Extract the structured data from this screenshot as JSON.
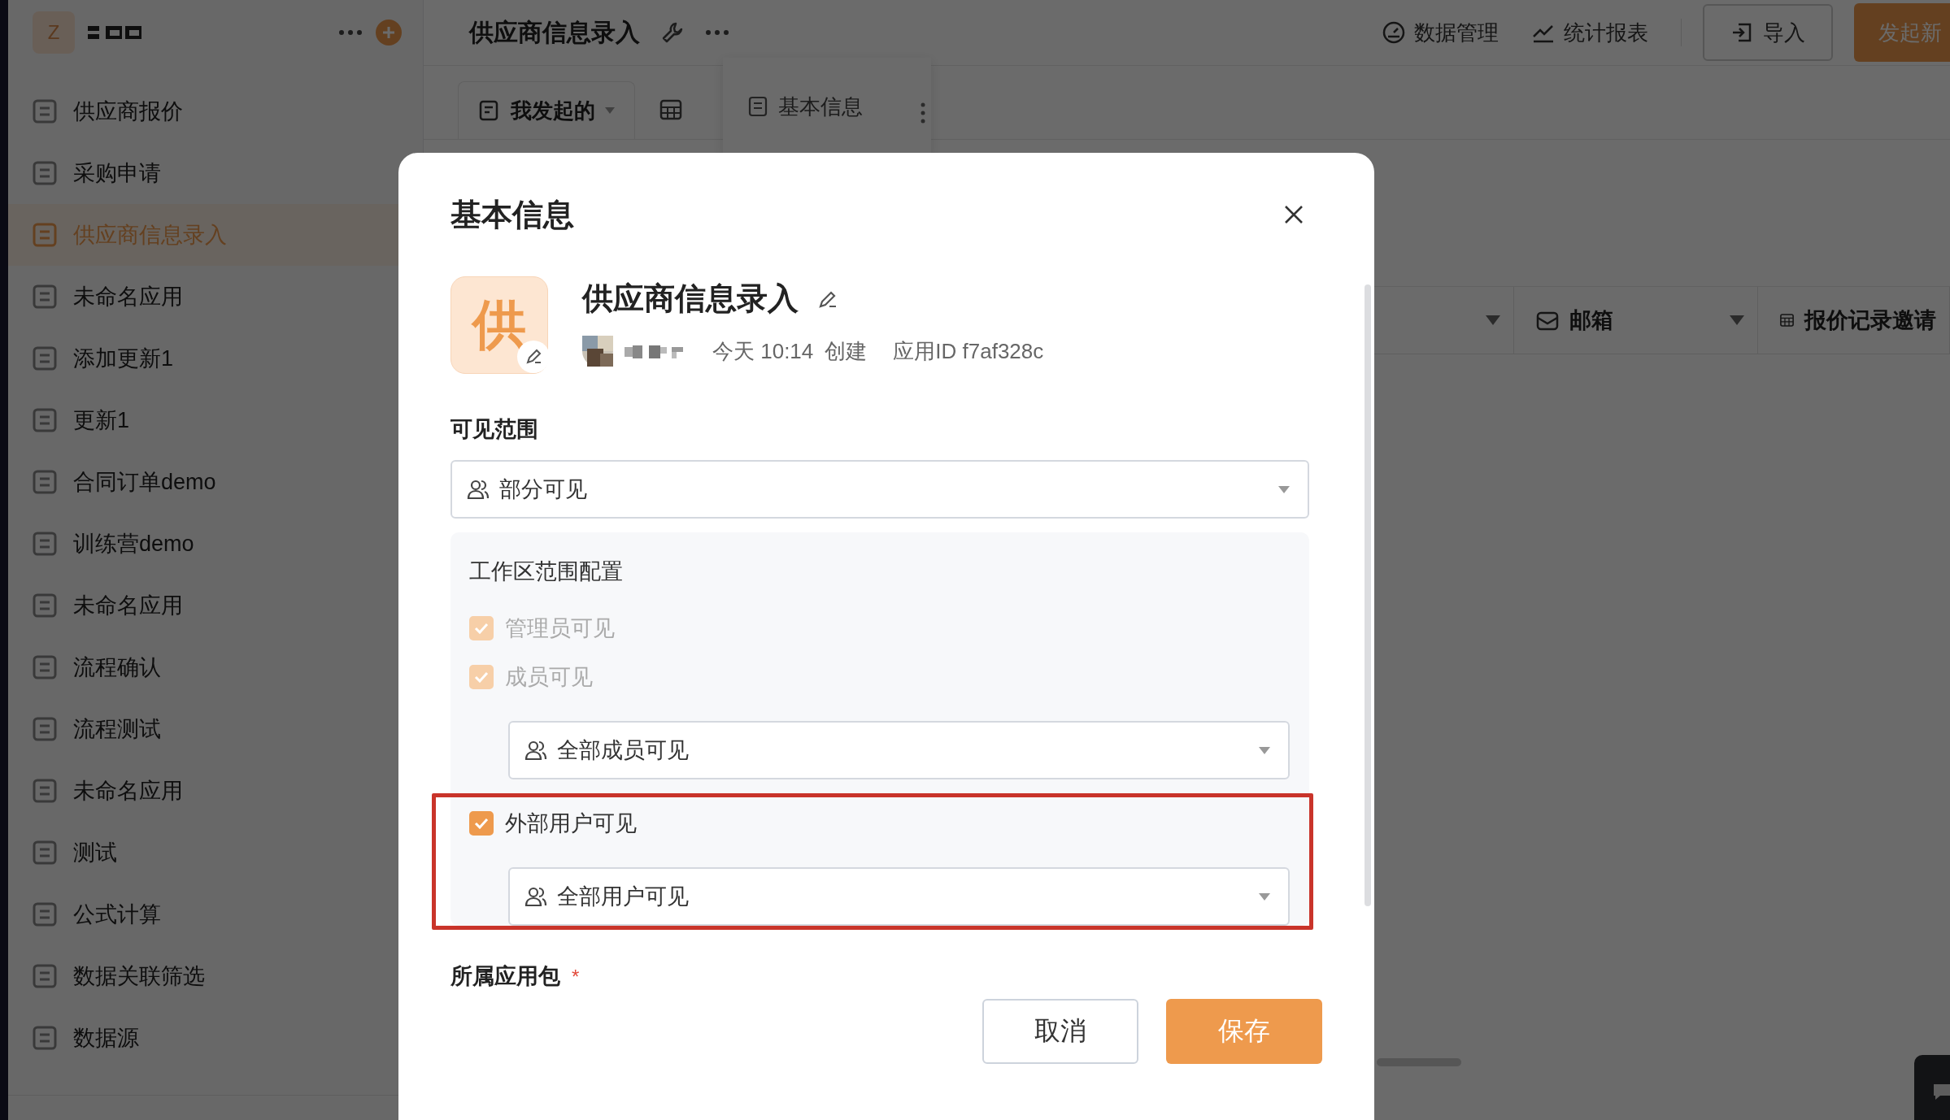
{
  "sidebar": {
    "workspace_initial": "Z",
    "items": [
      {
        "label": "供应商报价",
        "selected": false
      },
      {
        "label": "采购申请",
        "selected": false
      },
      {
        "label": "供应商信息录入",
        "selected": true
      },
      {
        "label": "未命名应用",
        "selected": false
      },
      {
        "label": "添加更新1",
        "selected": false
      },
      {
        "label": "更新1",
        "selected": false
      },
      {
        "label": "合同订单demo",
        "selected": false
      },
      {
        "label": "训练营demo",
        "selected": false
      },
      {
        "label": "未命名应用",
        "selected": false
      },
      {
        "label": "流程确认",
        "selected": false
      },
      {
        "label": "流程测试",
        "selected": false
      },
      {
        "label": "未命名应用",
        "selected": false
      },
      {
        "label": "测试",
        "selected": false
      },
      {
        "label": "公式计算",
        "selected": false
      },
      {
        "label": "数据关联筛选",
        "selected": false
      },
      {
        "label": "数据源",
        "selected": false
      }
    ]
  },
  "topbar": {
    "title": "供应商信息录入",
    "actions": [
      {
        "kind": "gauge",
        "label": "数据管理"
      },
      {
        "kind": "chart",
        "label": "统计报表"
      }
    ],
    "import_button": "导入",
    "primary_button": "发起新"
  },
  "view_tabs": [
    {
      "label": "我发起的",
      "selected": true
    }
  ],
  "tab_popup": {
    "label": "基本信息"
  },
  "columns": [
    {
      "kind": "mail",
      "label": "邮箱"
    },
    {
      "kind": "table",
      "label": "报价记录邀请"
    }
  ],
  "dialog": {
    "title": "基本信息",
    "app_icon_char": "供",
    "app_name": "供应商信息录入",
    "created_time": "今天 10:14",
    "created_label": "创建",
    "app_id": "应用ID f7af328c",
    "visibility_label": "可见范围",
    "visibility_value": "部分可见",
    "workspace_panel": {
      "title": "工作区范围配置",
      "options": [
        {
          "label": "管理员可见",
          "checked": true,
          "disabled": true,
          "highlighted": false
        },
        {
          "label": "成员可见",
          "checked": true,
          "disabled": true,
          "highlighted": false,
          "select": "全部成员可见"
        },
        {
          "label": "外部用户可见",
          "checked": true,
          "disabled": false,
          "highlighted": true,
          "select": "全部用户可见"
        }
      ]
    },
    "package_label": "所属应用包",
    "required_mark": "*",
    "cancel_button": "取消",
    "save_button": "保存"
  }
}
